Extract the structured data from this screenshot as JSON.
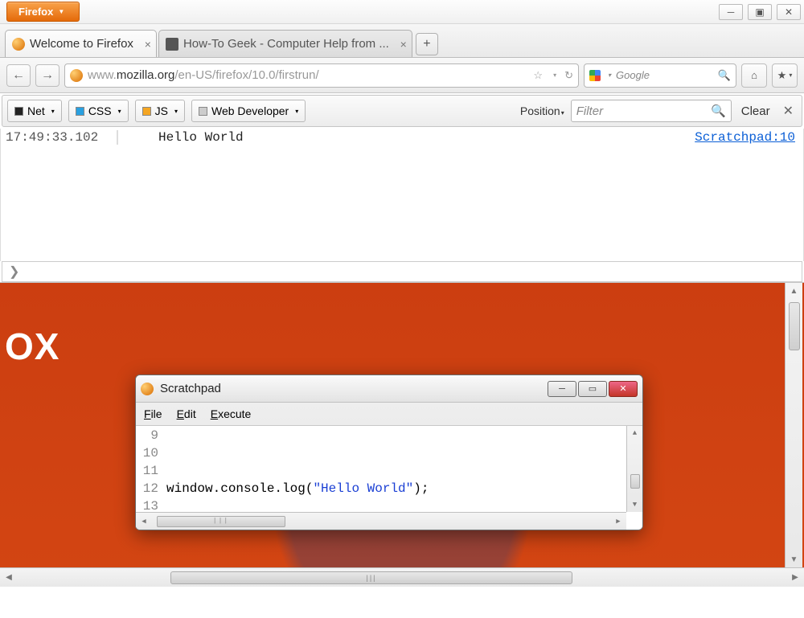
{
  "menubar": {
    "firefox_label": "Firefox"
  },
  "window_controls": {
    "min": "─",
    "max": "▣",
    "close": "✕"
  },
  "tabs": [
    {
      "title": "Welcome to Firefox",
      "active": true
    },
    {
      "title": "How-To Geek - Computer Help from ...",
      "active": false
    }
  ],
  "nav": {
    "url_pre": "www.",
    "url_host": "mozilla.org",
    "url_path": "/en-US/firefox/10.0/firstrun/",
    "search_placeholder": "Google"
  },
  "devbar": {
    "net": "Net",
    "css": "CSS",
    "js": "JS",
    "webdev": "Web Developer",
    "position": "Position",
    "filter_placeholder": "Filter",
    "clear": "Clear"
  },
  "console": {
    "timestamp": "17:49:33.102",
    "message": "Hello World",
    "source": "Scratchpad:10"
  },
  "page": {
    "ox_text": "OX"
  },
  "scratchpad": {
    "title": "Scratchpad",
    "menu": {
      "file": "File",
      "edit": "Edit",
      "execute": "Execute"
    },
    "lines": [
      "9",
      "10",
      "11",
      "12",
      "13"
    ],
    "code_prefix": "window.console.log(",
    "code_string": "\"Hello World\"",
    "code_suffix": ");"
  }
}
